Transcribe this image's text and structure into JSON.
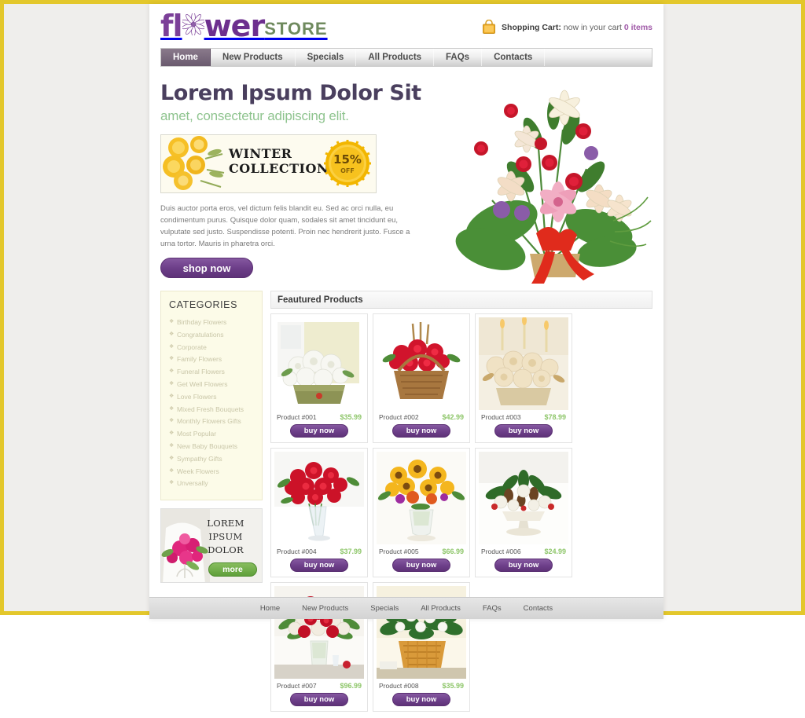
{
  "theme": {
    "frame_border": "#e3c72b",
    "purple": "#6d3f89",
    "green": "#8fc48f",
    "price_green": "#8ec66a",
    "cream": "#fcfbe8"
  },
  "header": {
    "logo": {
      "part1": "fl",
      "part2": "wer",
      "part3": "STORE",
      "flower_icon": "flower-icon"
    },
    "cart": {
      "icon": "shopping-bag-icon",
      "label": "Shopping Cart:",
      "text": " now in your cart ",
      "count": "0 items"
    }
  },
  "nav": {
    "items": [
      {
        "label": "Home",
        "active": true
      },
      {
        "label": "New Products",
        "active": false
      },
      {
        "label": "Specials",
        "active": false
      },
      {
        "label": "All Products",
        "active": false
      },
      {
        "label": "FAQs",
        "active": false
      },
      {
        "label": "Contacts",
        "active": false
      }
    ]
  },
  "hero": {
    "title": "Lorem Ipsum Dolor Sit",
    "subtitle": "amet, consectetur adipiscing elit.",
    "banner": {
      "line1": "WINTER",
      "line2": "COLLECTION",
      "badge_value": "15%",
      "badge_label": "OFF"
    },
    "body": "Duis auctor porta eros, vel dictum felis blandit eu. Sed ac orci nulla, eu condimentum purus. Quisque dolor quam, sodales sit amet tincidunt eu, vulputate sed justo. Suspendisse potenti. Proin nec hendrerit justo. Fusce a urna tortor. Mauris in pharetra orci.",
    "cta": "shop now",
    "image": "flower-bouquet-arrangement"
  },
  "sidebar": {
    "categories_title": "CATEGORIES",
    "categories": [
      "Birthday Flowers",
      "Congratulations",
      "Corporate",
      "Family Flowers",
      "Funeral Flowers",
      "Get Well Flowers",
      "Love Flowers",
      "Mixed Fresh Bouquets",
      "Monthly Flowers Gifts",
      "Most Popular",
      "New Baby Bouquets",
      "Sympathy Gifts",
      "Week Flowers",
      "Unversally"
    ],
    "promo": {
      "line1": "LOREM IPSUM",
      "line2": "DOLOR",
      "button": "more",
      "image": "bride-holding-pink-bouquet"
    }
  },
  "main": {
    "featured_title": "Feautured Products",
    "buy_label": "buy now",
    "products": [
      {
        "name": "Product #001",
        "price": "$35.99",
        "image": "white-flowers-in-green-tin"
      },
      {
        "name": "Product #002",
        "price": "$42.99",
        "image": "red-roses-basket"
      },
      {
        "name": "Product #003",
        "price": "$78.99",
        "image": "cream-roses-with-candles"
      },
      {
        "name": "Product #004",
        "price": "$37.99",
        "image": "red-roses-in-glass-vase"
      },
      {
        "name": "Product #005",
        "price": "$66.99",
        "image": "yellow-mixed-bouquet-vase"
      },
      {
        "name": "Product #006",
        "price": "$24.99",
        "image": "white-centerpiece-with-pinecones"
      },
      {
        "name": "Product #007",
        "price": "$96.99",
        "image": "red-roses-and-lilies-vase"
      },
      {
        "name": "Product #008",
        "price": "$35.99",
        "image": "green-plant-in-wicker-basket"
      }
    ]
  },
  "footer": {
    "items": [
      "Home",
      "New Products",
      "Specials",
      "All Products",
      "FAQs",
      "Contacts"
    ]
  }
}
